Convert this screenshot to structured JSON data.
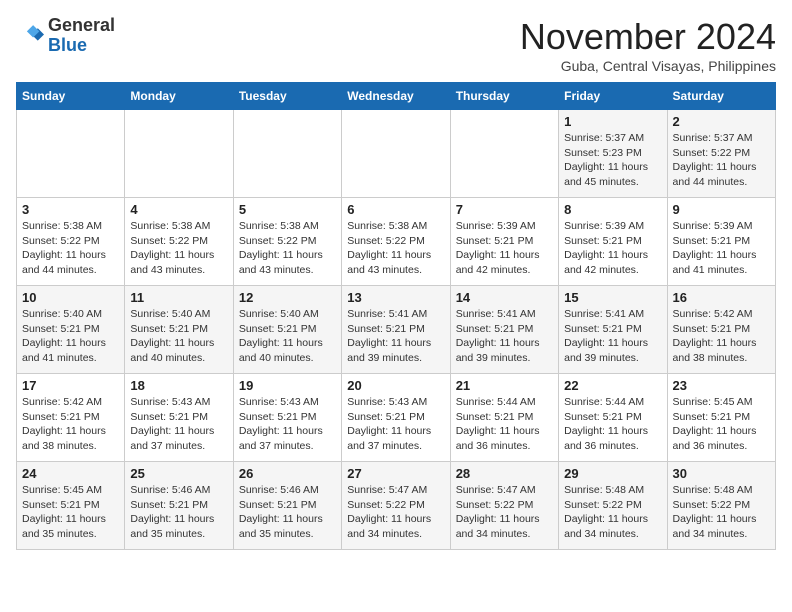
{
  "logo": {
    "line1": "General",
    "line2": "Blue"
  },
  "header": {
    "month": "November 2024",
    "location": "Guba, Central Visayas, Philippines"
  },
  "weekdays": [
    "Sunday",
    "Monday",
    "Tuesday",
    "Wednesday",
    "Thursday",
    "Friday",
    "Saturday"
  ],
  "weeks": [
    [
      {
        "day": "",
        "info": ""
      },
      {
        "day": "",
        "info": ""
      },
      {
        "day": "",
        "info": ""
      },
      {
        "day": "",
        "info": ""
      },
      {
        "day": "",
        "info": ""
      },
      {
        "day": "1",
        "info": "Sunrise: 5:37 AM\nSunset: 5:23 PM\nDaylight: 11 hours\nand 45 minutes."
      },
      {
        "day": "2",
        "info": "Sunrise: 5:37 AM\nSunset: 5:22 PM\nDaylight: 11 hours\nand 44 minutes."
      }
    ],
    [
      {
        "day": "3",
        "info": "Sunrise: 5:38 AM\nSunset: 5:22 PM\nDaylight: 11 hours\nand 44 minutes."
      },
      {
        "day": "4",
        "info": "Sunrise: 5:38 AM\nSunset: 5:22 PM\nDaylight: 11 hours\nand 43 minutes."
      },
      {
        "day": "5",
        "info": "Sunrise: 5:38 AM\nSunset: 5:22 PM\nDaylight: 11 hours\nand 43 minutes."
      },
      {
        "day": "6",
        "info": "Sunrise: 5:38 AM\nSunset: 5:22 PM\nDaylight: 11 hours\nand 43 minutes."
      },
      {
        "day": "7",
        "info": "Sunrise: 5:39 AM\nSunset: 5:21 PM\nDaylight: 11 hours\nand 42 minutes."
      },
      {
        "day": "8",
        "info": "Sunrise: 5:39 AM\nSunset: 5:21 PM\nDaylight: 11 hours\nand 42 minutes."
      },
      {
        "day": "9",
        "info": "Sunrise: 5:39 AM\nSunset: 5:21 PM\nDaylight: 11 hours\nand 41 minutes."
      }
    ],
    [
      {
        "day": "10",
        "info": "Sunrise: 5:40 AM\nSunset: 5:21 PM\nDaylight: 11 hours\nand 41 minutes."
      },
      {
        "day": "11",
        "info": "Sunrise: 5:40 AM\nSunset: 5:21 PM\nDaylight: 11 hours\nand 40 minutes."
      },
      {
        "day": "12",
        "info": "Sunrise: 5:40 AM\nSunset: 5:21 PM\nDaylight: 11 hours\nand 40 minutes."
      },
      {
        "day": "13",
        "info": "Sunrise: 5:41 AM\nSunset: 5:21 PM\nDaylight: 11 hours\nand 39 minutes."
      },
      {
        "day": "14",
        "info": "Sunrise: 5:41 AM\nSunset: 5:21 PM\nDaylight: 11 hours\nand 39 minutes."
      },
      {
        "day": "15",
        "info": "Sunrise: 5:41 AM\nSunset: 5:21 PM\nDaylight: 11 hours\nand 39 minutes."
      },
      {
        "day": "16",
        "info": "Sunrise: 5:42 AM\nSunset: 5:21 PM\nDaylight: 11 hours\nand 38 minutes."
      }
    ],
    [
      {
        "day": "17",
        "info": "Sunrise: 5:42 AM\nSunset: 5:21 PM\nDaylight: 11 hours\nand 38 minutes."
      },
      {
        "day": "18",
        "info": "Sunrise: 5:43 AM\nSunset: 5:21 PM\nDaylight: 11 hours\nand 37 minutes."
      },
      {
        "day": "19",
        "info": "Sunrise: 5:43 AM\nSunset: 5:21 PM\nDaylight: 11 hours\nand 37 minutes."
      },
      {
        "day": "20",
        "info": "Sunrise: 5:43 AM\nSunset: 5:21 PM\nDaylight: 11 hours\nand 37 minutes."
      },
      {
        "day": "21",
        "info": "Sunrise: 5:44 AM\nSunset: 5:21 PM\nDaylight: 11 hours\nand 36 minutes."
      },
      {
        "day": "22",
        "info": "Sunrise: 5:44 AM\nSunset: 5:21 PM\nDaylight: 11 hours\nand 36 minutes."
      },
      {
        "day": "23",
        "info": "Sunrise: 5:45 AM\nSunset: 5:21 PM\nDaylight: 11 hours\nand 36 minutes."
      }
    ],
    [
      {
        "day": "24",
        "info": "Sunrise: 5:45 AM\nSunset: 5:21 PM\nDaylight: 11 hours\nand 35 minutes."
      },
      {
        "day": "25",
        "info": "Sunrise: 5:46 AM\nSunset: 5:21 PM\nDaylight: 11 hours\nand 35 minutes."
      },
      {
        "day": "26",
        "info": "Sunrise: 5:46 AM\nSunset: 5:21 PM\nDaylight: 11 hours\nand 35 minutes."
      },
      {
        "day": "27",
        "info": "Sunrise: 5:47 AM\nSunset: 5:22 PM\nDaylight: 11 hours\nand 34 minutes."
      },
      {
        "day": "28",
        "info": "Sunrise: 5:47 AM\nSunset: 5:22 PM\nDaylight: 11 hours\nand 34 minutes."
      },
      {
        "day": "29",
        "info": "Sunrise: 5:48 AM\nSunset: 5:22 PM\nDaylight: 11 hours\nand 34 minutes."
      },
      {
        "day": "30",
        "info": "Sunrise: 5:48 AM\nSunset: 5:22 PM\nDaylight: 11 hours\nand 34 minutes."
      }
    ]
  ]
}
